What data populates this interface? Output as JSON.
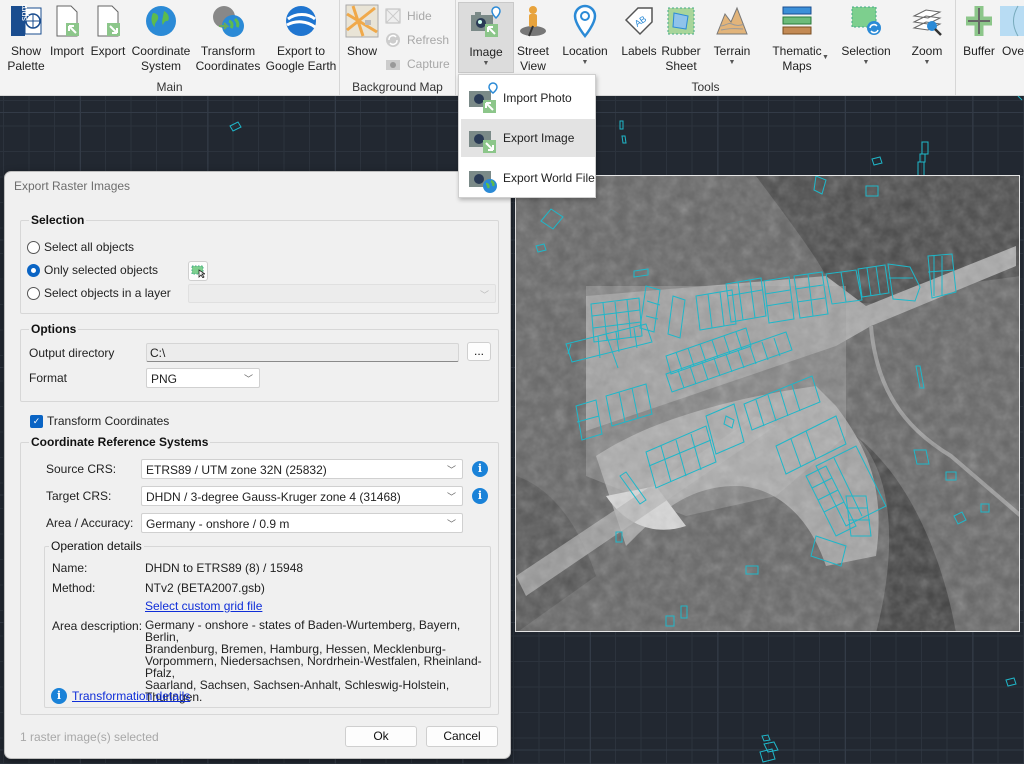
{
  "ribbon": {
    "groups": {
      "main": "Main",
      "background_map": "Background Map",
      "tools": "Tools"
    },
    "main": {
      "show_palette": [
        "Show",
        "Palette"
      ],
      "import": "Import",
      "export": "Export",
      "coordinate_system": [
        "Coordinate",
        "System"
      ],
      "transform_coordinates": [
        "Transform",
        "Coordinates"
      ],
      "export_google_earth": [
        "Export to",
        "Google Earth"
      ]
    },
    "background_map": {
      "show": "Show",
      "hide": "Hide",
      "refresh": "Refresh",
      "capture": "Capture"
    },
    "tools": {
      "image": "Image",
      "street_view": [
        "Street",
        "View"
      ],
      "location": "Location",
      "labels": "Labels",
      "rubber_sheet": [
        "Rubber",
        "Sheet"
      ],
      "terrain": "Terrain",
      "thematic_maps": [
        "Thematic",
        "Maps"
      ],
      "selection": "Selection",
      "zoom": "Zoom"
    },
    "extra": {
      "buffer": "Buffer",
      "overlay": "Over"
    }
  },
  "image_menu": {
    "items": [
      {
        "label": "Import Photo"
      },
      {
        "label": "Export Image"
      },
      {
        "label": "Export World File"
      }
    ],
    "highlighted": "Export Image"
  },
  "dialog": {
    "title": "Export Raster Images",
    "selection": {
      "heading": "Selection",
      "options": [
        "Select all objects",
        "Only selected objects",
        "Select objects in a layer"
      ],
      "selected": "Only selected objects",
      "layer_value": ""
    },
    "options": {
      "heading": "Options",
      "output_directory_label": "Output directory",
      "output_directory_value": "C:\\",
      "browse_label": "...",
      "format_label": "Format",
      "format_value": "PNG"
    },
    "transform": {
      "label": "Transform Coordinates",
      "checked": true
    },
    "crs": {
      "heading": "Coordinate Reference Systems",
      "source_label": "Source CRS:",
      "source_value": "ETRS89 / UTM zone 32N (25832)",
      "target_label": "Target CRS:",
      "target_value": "DHDN / 3-degree Gauss-Kruger zone 4 (31468)",
      "area_label": "Area / Accuracy:",
      "area_value": "Germany - onshore / 0.9 m",
      "operation": {
        "heading": "Operation details",
        "name_label": "Name:",
        "name_value": "DHDN to ETRS89 (8) / 15948",
        "method_label": "Method:",
        "method_value": "NTv2 (BETA2007.gsb)",
        "custom_grid_link": "Select custom grid file",
        "area_desc_label": "Area description:",
        "area_desc_lines": [
          "Germany - onshore - states of Baden-Wurtemberg, Bayern, Berlin,",
          "Brandenburg, Bremen, Hamburg, Hessen, Mecklenburg-",
          "Vorpommern, Niedersachsen, Nordrhein-Westfalen, Rheinland-Pfalz,",
          "Saarland, Sachsen, Sachsen-Anhalt, Schleswig-Holstein, Thuringen."
        ],
        "details_link": "Transformation details"
      }
    },
    "status": "1 raster image(s) selected",
    "ok_label": "Ok",
    "cancel_label": "Cancel"
  },
  "colors": {
    "accent": "#0a64c4",
    "outline": "#1fb7c9",
    "canvas": "#222831"
  }
}
